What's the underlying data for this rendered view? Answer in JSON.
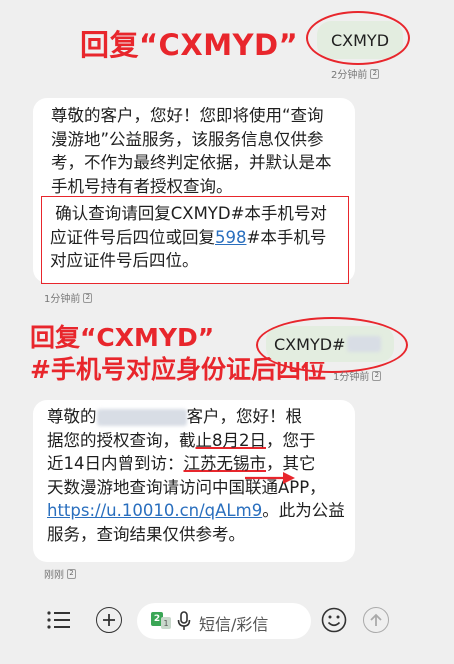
{
  "annotation_top": {
    "text": "回复“CXMYD”"
  },
  "sent_1": {
    "text": "CXMYD",
    "time": "2分钟前",
    "sim": "2"
  },
  "recv_1": {
    "line1": "尊敬的客户，您好！您即将使用“查询",
    "line2": "漫游地”公益服务，该服务信息仅供参",
    "line3": "考，不作为最终判定依据，并默认是本",
    "line4": "手机号持有者授权查询。",
    "box_line1": " 确认查询请回复CXMYD#本手机号对",
    "box_line2a": "应证件号后四位或回复",
    "box_line2_link": "598",
    "box_line2b": "#本手机号",
    "box_line3": "对应证件号后四位。",
    "time": "1分钟前",
    "sim": "2"
  },
  "annotation_mid": {
    "line1": "回复“CXMYD”",
    "line2": "#手机号对应身份证后四位"
  },
  "sent_2": {
    "text": "CXMYD#",
    "time": "1分钟前",
    "sim": "2"
  },
  "recv_2": {
    "line1a": "尊敬的",
    "line1b": "客户，您好！根",
    "line2a": "据您的授权查询，截",
    "line2_highlight": "止8月2日",
    "line2b": "，您于",
    "line3a": "近14日内曾到访：",
    "line3_highlight": "江苏无锡市",
    "line3b": "，其它",
    "line4": "天数漫游地查询请访问中国联通APP，",
    "line5_link": "https://u.10010.cn/qALm9",
    "line5b": "。此为公益",
    "line6": "服务，查询结果仅供参考。",
    "time": "刚刚",
    "sim": "2"
  },
  "composer": {
    "menu_icon": "menu-icon",
    "add_icon": "plus-circle-icon",
    "sim_icon": "dual-sim-icon",
    "sim_label": "2",
    "sim_sub": "1",
    "mic_icon": "microphone-icon",
    "placeholder": "短信/彩信",
    "emoji_icon": "emoji-icon",
    "send_icon": "send-arrow-icon"
  },
  "colors": {
    "annotation_red": "#e8262c",
    "link_blue": "#2a6fbe",
    "sim_green": "#3aa655"
  }
}
